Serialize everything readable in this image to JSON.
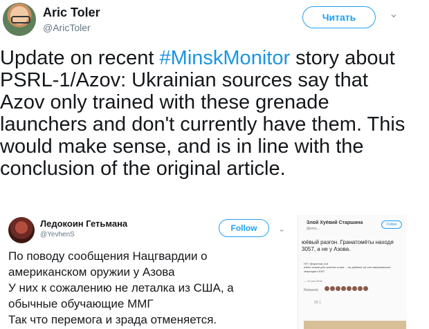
{
  "tweet": {
    "author_name": "Aric Toler",
    "author_handle": "@AricToler",
    "follow_label": "Читать",
    "text_prefix": "Update on recent ",
    "hashtag": "#MinskMonitor",
    "text_suffix": " story about PSRL-1/Azov: Ukrainian sources say that Azov only trained with these grenade launchers and don't currently have them. This would make sense, and is in line with the conclusion of the original article."
  },
  "embedded_tweet": {
    "author_name": "Ледокоин Гетьмана",
    "author_handle": "@YevhenS",
    "follow_label": "Follow",
    "text_lines": [
      "По поводу сообщения Нацгвардии о",
      "американском оружии у Азова",
      "У них к сожалению не леталка из США, а",
      "обычные обучающие ММГ",
      "Так что перемога и зрада отменяется."
    ]
  },
  "quoted_screenshot": {
    "author_name": "Злой Хуёвий Старшина",
    "author_handle": "@eros...",
    "follow_label": "Follow",
    "text": "юёвый разгон. Гранатомёты находя 3057, а не у Азова.",
    "meta_1": "НГУ @sportnat_bot",
    "meta_2": "найти кошки для тройчих нозки ... на добавит же сли американськи",
    "meta_3": "зеприодніз 3057",
    "date": "— 10 сек 2018",
    "retweets": "Retweets",
    "actions": "20    1",
    "icon_names": [
      "heart-icon",
      "retweet-icon",
      "reply-icon"
    ]
  },
  "icons": {
    "caret": "chevron-down-icon"
  },
  "colors": {
    "accent": "#1da1f2",
    "text": "#14171a",
    "muted": "#657786"
  }
}
